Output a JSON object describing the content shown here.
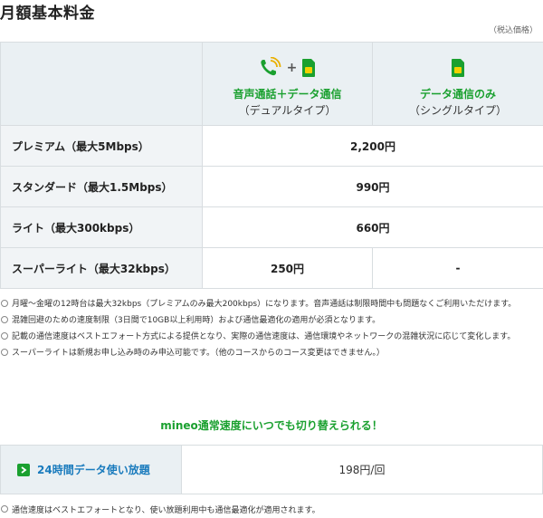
{
  "page": {
    "title": "月額基本料金",
    "tax_note": "（税込価格）"
  },
  "plans": [
    {
      "title": "音声通話＋データ通信",
      "subtitle": "（デュアルタイプ）",
      "icons": [
        "phone-icon",
        "plus-sign",
        "sim-card-icon"
      ]
    },
    {
      "title": "データ通信のみ",
      "subtitle": "（シングルタイプ）",
      "icons": [
        "sim-card-icon"
      ]
    }
  ],
  "rows": [
    {
      "label": "プレミアム（最大5Mbps）",
      "price_shared": "2,200円"
    },
    {
      "label": "スタンダード（最大1.5Mbps）",
      "price_shared": "990円"
    },
    {
      "label": "ライト（最大300kbps）",
      "price_shared": "660円"
    },
    {
      "label": "スーパーライト（最大32kbps）",
      "price_dual": "250円",
      "price_single": "-"
    }
  ],
  "notes": [
    "月曜～金曜の12時台は最大32kbps（プレミアムのみ最大200kbps）になります。音声通話は制限時間中も問題なくご利用いただけます。",
    "混雑回避のための速度制限（3日間で10GB以上利用時）および通信最適化の適用が必須となります。",
    "記載の通信速度はベストエフォート方式による提供となり、実際の通信速度は、通信環境やネットワークの混雑状況に応じて変化します。",
    "スーパーライトは新規お申し込み時のみ申込可能です。（他のコースからのコース変更はできません。）"
  ],
  "promo": {
    "text": "mineo通常速度にいつでも切り替えられる！"
  },
  "unlimited": {
    "label": "24時間データ使い放題",
    "price": "198円/回"
  },
  "footer_note": "通信速度はベストエフォートとなり、使い放題利用中も通信最適化が適用されます。",
  "colors": {
    "accent_green": "#1aa02f",
    "link_blue": "#1a7bbd",
    "header_bg": "#eaf0f3",
    "border": "#d8dde0"
  }
}
